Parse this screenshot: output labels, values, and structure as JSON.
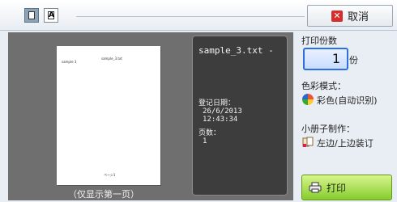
{
  "toolbar": {
    "view_buttons": [
      {
        "name": "page-view",
        "icon": "page-icon",
        "active": true
      },
      {
        "name": "text-view",
        "icon": "text-icon",
        "glyph": "A",
        "active": false
      }
    ],
    "cancel_label": "取消"
  },
  "preview": {
    "paper_texts": [
      "sample 3",
      "sample_3.txt",
      "ページ1"
    ],
    "caption": "（仅显示第一页）"
  },
  "info": {
    "filename": "sample_3.txt -",
    "date_label": "登记日期：",
    "date": "26/6/2013",
    "time": "12:43:34",
    "pages_label": "页数：",
    "pages": "1"
  },
  "settings": {
    "copies_label": "打印份数",
    "copies_value": "1",
    "copies_unit": "份",
    "color_mode_label": "色彩模式：",
    "color_mode_value": "彩色(自动识别)",
    "booklet_label": "小册子制作：",
    "booklet_value": "左边/上边装订",
    "print_label": "打印"
  },
  "colors": {
    "print_button": "#86cc2d",
    "copies_border": "#2c6fe0",
    "cancel_icon": "#d82b2b",
    "preview_bg": "#6f6f6f",
    "info_bg": "#3d3d3d"
  }
}
